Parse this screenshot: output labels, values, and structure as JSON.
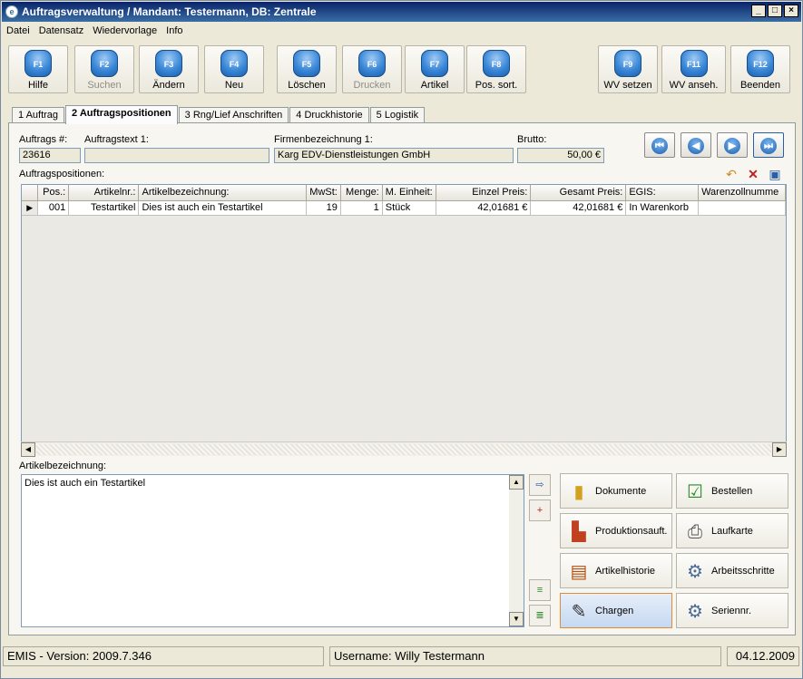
{
  "window": {
    "title": "Auftragsverwaltung / Mandant: Testermann, DB: Zentrale"
  },
  "menu": [
    "Datei",
    "Datensatz",
    "Wiedervorlage",
    "Info"
  ],
  "toolbar": [
    {
      "key": "F1",
      "label": "Hilfe",
      "enabled": true
    },
    {
      "key": "F2",
      "label": "Suchen",
      "enabled": false
    },
    {
      "key": "F3",
      "label": "Ändern",
      "enabled": true
    },
    {
      "key": "F4",
      "label": "Neu",
      "enabled": true
    },
    {
      "key": "F5",
      "label": "Löschen",
      "enabled": true
    },
    {
      "key": "F6",
      "label": "Drucken",
      "enabled": false
    },
    {
      "key": "F7",
      "label": "Artikel",
      "enabled": true
    },
    {
      "key": "F8",
      "label": "Pos. sort.",
      "enabled": true
    },
    {
      "key": "F9",
      "label": "WV setzen",
      "enabled": true
    },
    {
      "key": "F11",
      "label": "WV anseh.",
      "enabled": true
    },
    {
      "key": "F12",
      "label": "Beenden",
      "enabled": true
    }
  ],
  "tabs": [
    "1 Auftrag",
    "2 Auftragspositionen",
    "3 Rng/Lief Anschriften",
    "4 Druckhistorie",
    "5 Logistik"
  ],
  "active_tab": "2 Auftragspositionen",
  "header": {
    "auftrag_label": "Auftrags #:",
    "auftrag_value": "23616",
    "text_label": "Auftragstext 1:",
    "text_value": "",
    "firma_label": "Firmenbezeichnung 1:",
    "firma_value": "Karg EDV-Dienstleistungen GmbH",
    "brutto_label": "Brutto:",
    "brutto_value": "50,00 €"
  },
  "nav": {
    "first": "⏮",
    "prev": "◀",
    "next": "▶",
    "last": "⏭"
  },
  "positions": {
    "label": "Auftragspositionen:",
    "columns": [
      "Pos.:",
      "Artikelnr.:",
      "Artikelbezeichnung:",
      "MwSt:",
      "Menge:",
      "M. Einheit:",
      "Einzel Preis:",
      "Gesamt Preis:",
      "EGIS:",
      "Warenzollnumme"
    ],
    "rows": [
      [
        "001",
        "Testartikel",
        "Dies ist auch ein Testartikel",
        "19",
        "1",
        "Stück",
        "42,01681 €",
        "42,01681 €",
        "In Warenkorb",
        ""
      ]
    ]
  },
  "memo": {
    "label": "Artikelbezeichnung:",
    "text": "Dies ist auch ein Testartikel"
  },
  "actions": [
    {
      "label": "Dokumente",
      "icon": "folder-icon"
    },
    {
      "label": "Bestellen",
      "icon": "checklist-icon"
    },
    {
      "label": "Produktionsauft.",
      "icon": "factory-icon"
    },
    {
      "label": "Laufkarte",
      "icon": "printer-icon"
    },
    {
      "label": "Artikelhistorie",
      "icon": "film-icon"
    },
    {
      "label": "Arbeitsschritte",
      "icon": "gear-icon"
    },
    {
      "label": "Chargen",
      "icon": "signature-icon"
    },
    {
      "label": "Seriennr.",
      "icon": "serial-gear-icon"
    }
  ],
  "status": {
    "version": "EMIS - Version: 2009.7.346",
    "user": "Username: Willy Testermann",
    "date": "04.12.2009"
  }
}
